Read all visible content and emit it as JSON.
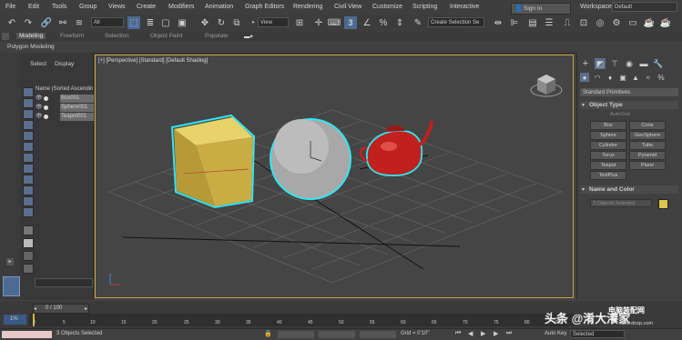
{
  "menubar": {
    "items": [
      "File",
      "Edit",
      "Tools",
      "Group",
      "Views",
      "Create",
      "Modifiers",
      "Animation",
      "Graph Editors",
      "Rendering",
      "Civil View",
      "Customize",
      "Scripting",
      "Interactive"
    ],
    "sign_in": "Sign In",
    "workspaces_label": "Workspaces:",
    "workspaces_value": "Default"
  },
  "toolbar": {
    "filter_dropdown": "All",
    "refcoord_dropdown": "View",
    "snap_value": "3",
    "selection_set": "Create Selection Se"
  },
  "ribbon": {
    "tabs": [
      "Modeling",
      "Freeform",
      "Selection",
      "Object Paint",
      "Populate"
    ],
    "sub_label": "Polygon Modeling"
  },
  "explorer": {
    "tabs": [
      "Select",
      "Display"
    ],
    "header": "Name (Sorted Ascendin",
    "items": [
      "Box001",
      "Sphere001",
      "Teapot001"
    ]
  },
  "viewport": {
    "label": "[+] [Perspective] [Standard] [Default Shading]"
  },
  "command_panel": {
    "category_dropdown": "Standard Primitives",
    "object_type_title": "Object Type",
    "autogrid": "AutoGrid",
    "buttons": [
      "Box",
      "Cone",
      "Sphere",
      "GeoSphere",
      "Cylinder",
      "Tube",
      "Torus",
      "Pyramid",
      "Teapot",
      "Plane",
      "TextPlus"
    ],
    "name_color_title": "Name and Color",
    "name_value": "3 Objects Selected",
    "swatch_color": "#e0c44c"
  },
  "timeline": {
    "frame_counter": "0 / 100",
    "ticks": [
      "0",
      "5",
      "10",
      "15",
      "20",
      "25",
      "30",
      "35",
      "40",
      "45",
      "50",
      "55",
      "60",
      "65",
      "70",
      "75",
      "80",
      "85"
    ]
  },
  "status": {
    "selected": "3 Objects Selected",
    "grid": "Grid = 0'10\"",
    "auto_key": "Auto Key",
    "selected_dropdown": "Selected",
    "fps_label": "1%"
  },
  "watermark": {
    "text": "头条 @淆大瀁家",
    "url": "www.dnzp.com",
    "logo": "电脑装配网"
  }
}
